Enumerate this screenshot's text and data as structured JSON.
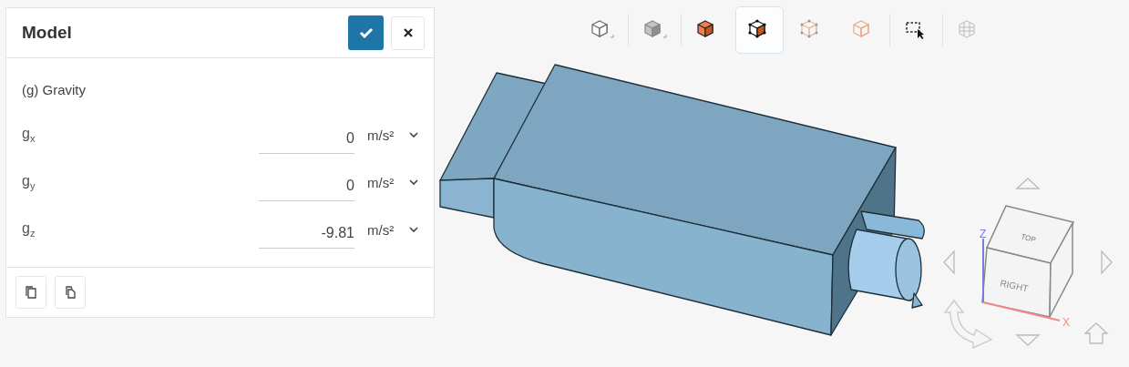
{
  "panel": {
    "title": "Model",
    "section": "(g) Gravity",
    "fields": [
      {
        "label": "g$_{x}$",
        "value": "0",
        "unit": "m/s²"
      },
      {
        "label": "g$_{y}$",
        "value": "0",
        "unit": "m/s²"
      },
      {
        "label": "g$_{z}$",
        "value": "-9.81",
        "unit": "m/s²"
      }
    ]
  },
  "toolbar": {
    "buttons": [
      {
        "kind": "wire-cube",
        "selected": false
      },
      {
        "kind": "solid-cube",
        "selected": false
      },
      {
        "kind": "filled-cube",
        "selected": false
      },
      {
        "kind": "edge-cube",
        "selected": true
      },
      {
        "kind": "points-cube",
        "selected": false
      },
      {
        "kind": "faint-cube",
        "selected": false
      },
      {
        "kind": "box-select",
        "selected": false
      },
      {
        "kind": "mesh",
        "selected": false
      }
    ]
  },
  "view_cube": {
    "faces": [
      "TOP",
      "RIGHT"
    ],
    "axes": [
      "Z",
      "X"
    ]
  }
}
